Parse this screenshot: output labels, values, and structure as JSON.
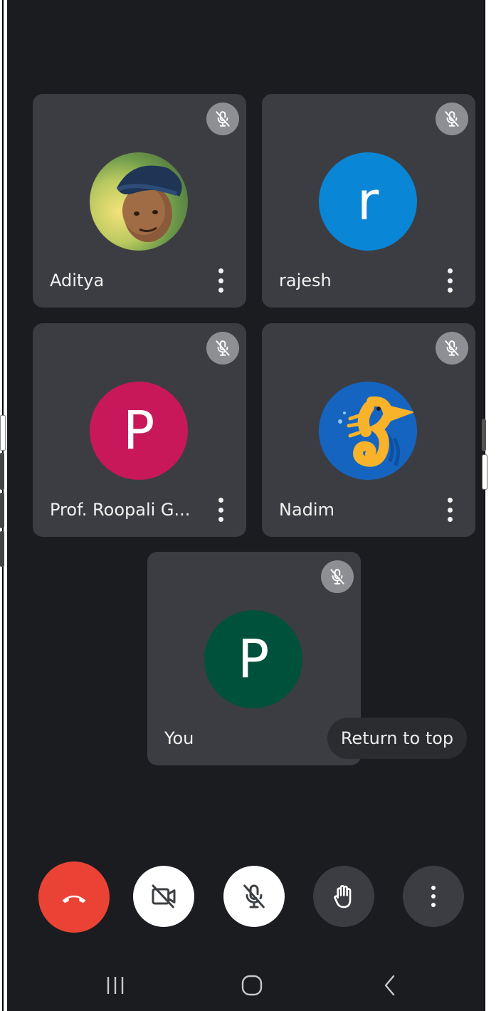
{
  "participants": [
    {
      "name": "Aditya",
      "avatar_type": "photo",
      "avatar_color": "#2f4f7f",
      "muted": true
    },
    {
      "name": "rajesh",
      "initial": "r",
      "avatar_color": "#0a86d6",
      "muted": true
    },
    {
      "name": "Prof. Roopali G...",
      "initial": "P",
      "avatar_color": "#c8185a",
      "muted": true
    },
    {
      "name": "Nadim",
      "avatar_type": "seahorse",
      "avatar_color": "#1565c0",
      "muted": true
    },
    {
      "name": "You",
      "initial": "P",
      "avatar_color": "#00513b",
      "muted": true
    }
  ],
  "return_to_top_label": "Return to top",
  "controls": {
    "end_call_color": "#ea4335",
    "camera_off_bg": "#ffffff",
    "mic_off_bg": "#ffffff",
    "raise_hand_bg": "#3c3d42",
    "more_bg": "#3c3d42"
  },
  "icons": {
    "mic_off": "mic-off-icon",
    "more": "more-vert-icon",
    "end_call": "call-end-icon",
    "camera_off": "videocam-off-icon",
    "raise_hand": "hand-icon",
    "nav_recents": "recents-icon",
    "nav_home": "home-icon",
    "nav_back": "back-icon"
  }
}
